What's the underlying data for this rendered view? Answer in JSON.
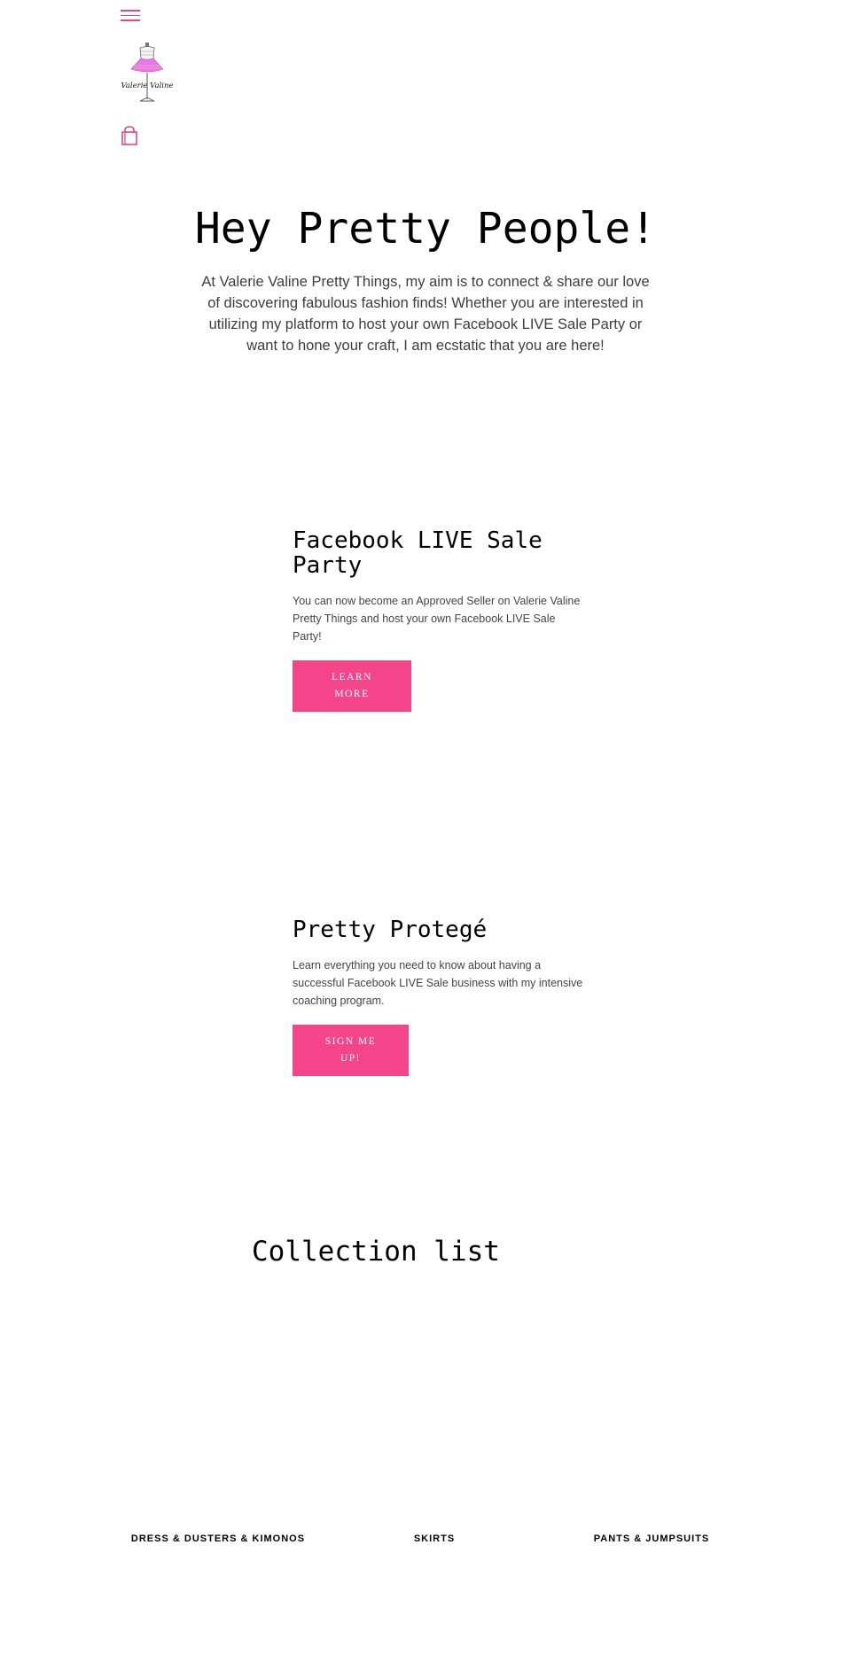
{
  "header": {
    "menu_icon": "hamburger-menu-icon",
    "logo_text": "Valerie Valine",
    "cart_icon": "shopping-bag-icon",
    "accent_color": "#e0468b"
  },
  "hero": {
    "title": "Hey Pretty People!",
    "text": "At Valerie Valine Pretty Things, my aim is to connect & share our love of discovering fabulous fashion finds! Whether you are interested in utilizing my platform to host your own Facebook LIVE Sale Party or want to hone your craft, I am ecstatic that you are here!"
  },
  "features": [
    {
      "title": "Facebook LIVE Sale Party",
      "text": "You can now become an Approved Seller on Valerie Valine Pretty Things and host your own Facebook LIVE Sale Party!",
      "button": "Learn more"
    },
    {
      "title": "Pretty Protegé",
      "text": "Learn everything you need to know about having a successful Facebook LIVE Sale business with my intensive coaching program.",
      "button": "Sign me up!"
    }
  ],
  "button_color": "#f5458a",
  "collection": {
    "title": "Collection list",
    "items": [
      {
        "label": "Dress & Dusters & Kimonos"
      },
      {
        "label": "Skirts"
      },
      {
        "label": "Pants & Jumpsuits"
      }
    ]
  }
}
